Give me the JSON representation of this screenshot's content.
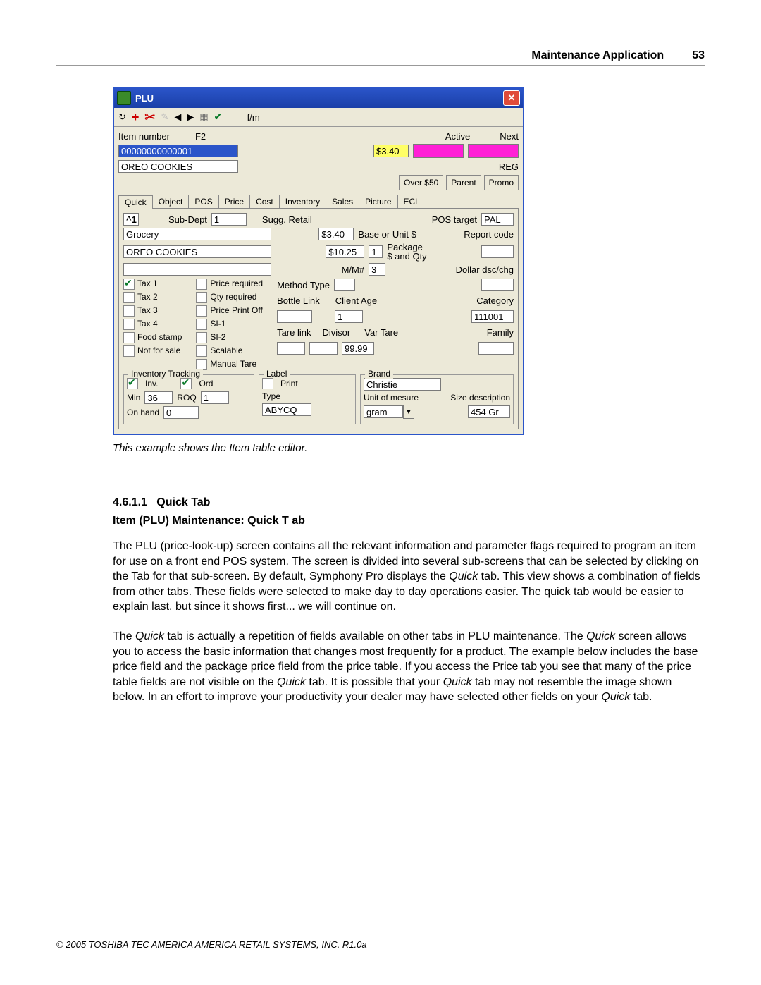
{
  "header": {
    "title": "Maintenance Application",
    "page": "53"
  },
  "win": {
    "title": "PLU",
    "fm": "f/m",
    "item_number_lbl": "Item number",
    "f2": "F2",
    "item_number": "00000000000001",
    "desc": "OREO COOKIES",
    "active": "Active",
    "next": "Next",
    "price": "$3.40",
    "reg": "REG",
    "btns": {
      "over50": "Over $50",
      "parent": "Parent",
      "promo": "Promo"
    },
    "tabs": [
      "Quick",
      "Object",
      "POS",
      "Price",
      "Cost",
      "Inventory",
      "Sales",
      "Picture",
      "ECL"
    ],
    "quick": {
      "subdept_lbl": "Sub-Dept",
      "subdept": "1",
      "subdept_name": "Grocery",
      "desc2": "OREO COOKIES",
      "sugg": "Sugg. Retail",
      "sugg_v": "$3.40",
      "base": "Base or Unit $",
      "pos_target_lbl": "POS target",
      "pos_target": "PAL",
      "report_code": "Report code",
      "pkg_price": "$10.25",
      "pkg_qty": "1",
      "pkg_lbl": "Package\n$ and Qty",
      "mm": "M/M#",
      "mm_v": "3",
      "dollar": "Dollar dsc/chg",
      "chk1": [
        "Tax 1",
        "Tax 2",
        "Tax 3",
        "Tax 4",
        "Food stamp",
        "Not for sale"
      ],
      "chk2": [
        "Price required",
        "Qty required",
        "Price Print Off",
        "SI-1",
        "SI-2",
        "Scalable",
        "Manual Tare"
      ],
      "method": "Method Type",
      "bottle": "Bottle Link",
      "client": "Client Age",
      "client_v": "1",
      "category": "Category",
      "category_v": "111001",
      "tare": "Tare link",
      "div": "Divisor",
      "var": "Var Tare",
      "var_v": "99.99",
      "family": "Family",
      "inv": {
        "legend": "Inventory Tracking",
        "inv": "Inv.",
        "ord": "Ord",
        "min_lbl": "Min",
        "min": "36",
        "roq_lbl": "ROQ",
        "roq": "1",
        "onhand_lbl": "On hand",
        "onhand": "0"
      },
      "label": {
        "legend": "Label",
        "print": "Print",
        "type_lbl": "Type",
        "type": "ABYCQ"
      },
      "brand": {
        "legend": "Brand",
        "brand": "Christie",
        "unit_lbl": "Unit of mesure",
        "unit": "gram",
        "size_lbl": "Size description",
        "size": "454 Gr"
      }
    }
  },
  "caption": "This example shows the Item table editor.",
  "sec_num": "4.6.1.1",
  "sec_title": "Quick Tab",
  "subtitle": "Item (PLU) Maintenance: Quick  T ab",
  "p1a": "The PLU (price-look-up) screen contains all the relevant information and parameter flags required to program an item for use on a front end POS system. The screen is divided into several sub-screens that can be selected by clicking on the Tab for that sub-screen. By default, Symphony Pro displays the ",
  "p1_i": "Quick",
  "p1b": " tab. This view shows a combination of fields from other tabs. These fields were selected to make day to day operations easier. The quick tab would be easier to explain last, but since it shows first... we will continue on.",
  "p2a": " The ",
  "p2_i1": "Quick",
  "p2b": " tab is actually a repetition of fields available on other tabs in PLU maintenance. The ",
  "p2_i2": "Quick",
  "p2c": " screen allows you to access the basic information that changes most frequently for a product. The example below includes the base price field and the package price field from the price table. If you access the Price tab you see that many of the price table fields are not visible on the ",
  "p2_i3": "Quick",
  "p2d": " tab. It is possible that your ",
  "p2_i4": "Quick",
  "p2e": " tab may not resemble the image shown below. In an effort to improve your productivity your dealer may have selected other fields on your ",
  "p2_i5": "Quick",
  "p2f": " tab.",
  "footer": "© 2005 TOSHIBA TEC AMERICA AMERICA RETAIL SYSTEMS, INC.   R1.0a"
}
